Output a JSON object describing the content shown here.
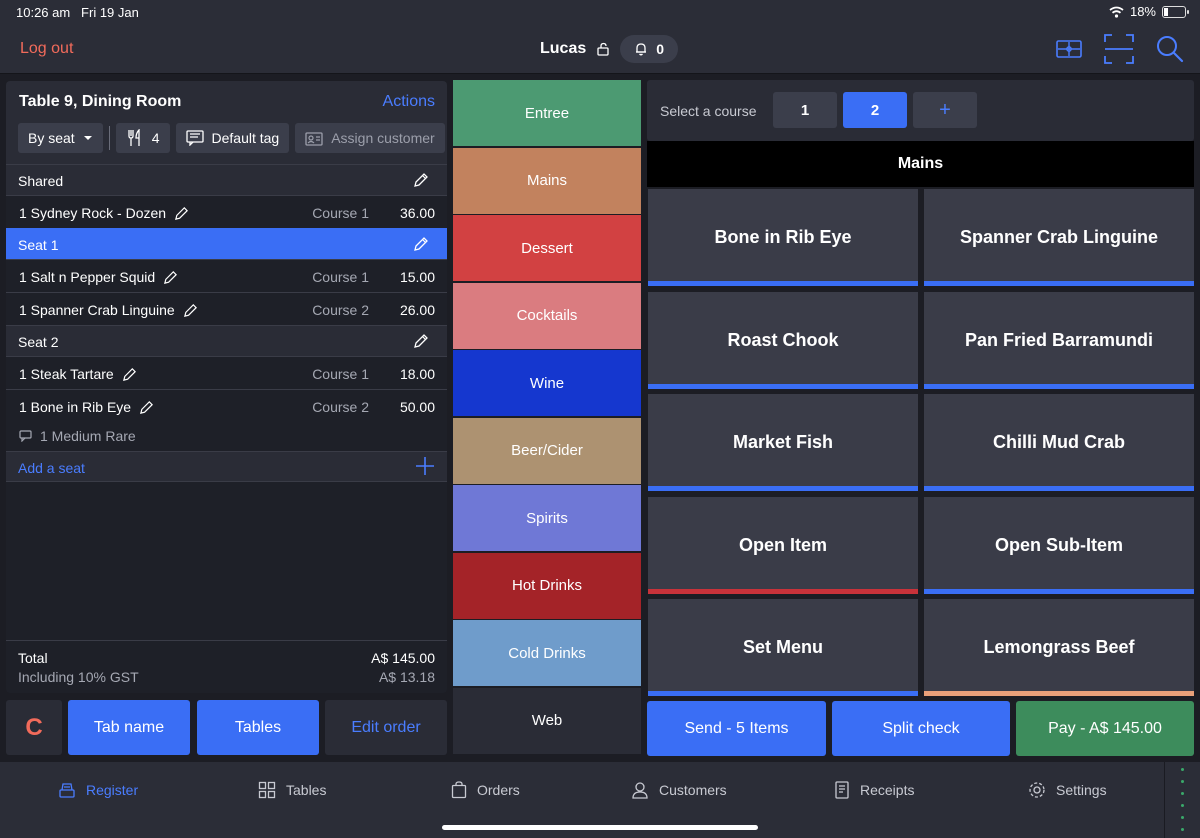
{
  "status": {
    "time": "10:26 am",
    "date": "Fri 19 Jan",
    "battery": "18%",
    "battery_level": 0.18
  },
  "top": {
    "logout": "Log out",
    "user": "Lucas",
    "notifications": "0"
  },
  "order": {
    "title": "Table 9, Dining Room",
    "actions": "Actions",
    "view": "By seat",
    "covers": "4",
    "tag": "Default tag",
    "assign": "Assign customer",
    "shared_label": "Shared",
    "shared_items": [
      {
        "name": "1  Sydney Rock - Dozen",
        "course": "Course 1",
        "price": "36.00"
      }
    ],
    "seat1_label": "Seat 1",
    "seat1_items": [
      {
        "name": "1  Salt n Pepper Squid",
        "course": "Course 1",
        "price": "15.00"
      },
      {
        "name": "1  Spanner Crab Linguine",
        "course": "Course 2",
        "price": "26.00"
      }
    ],
    "seat2_label": "Seat 2",
    "seat2_items": [
      {
        "name": "1  Steak Tartare",
        "course": "Course 1",
        "price": "18.00"
      },
      {
        "name": "1  Bone in Rib Eye",
        "course": "Course 2",
        "price": "50.00",
        "modifier": "1  Medium Rare"
      }
    ],
    "add_seat": "Add a seat",
    "total_label": "Total",
    "total_value": "A$ 145.00",
    "gst_label": "Including 10% GST",
    "gst_value": "A$ 13.18"
  },
  "left_buttons": {
    "clear": "C",
    "tab_name": "Tab name",
    "tables": "Tables",
    "edit_order": "Edit order"
  },
  "categories": [
    {
      "label": "Entree",
      "color": "#4c9a72"
    },
    {
      "label": "Mains",
      "color": "#c2825e"
    },
    {
      "label": "Dessert",
      "color": "#d24142"
    },
    {
      "label": "Cocktails",
      "color": "#da7c80"
    },
    {
      "label": "Wine",
      "color": "#1537cf"
    },
    {
      "label": "Beer/Cider",
      "color": "#ad9271"
    },
    {
      "label": "Spirits",
      "color": "#6f78d6"
    },
    {
      "label": "Hot Drinks",
      "color": "#a42328"
    },
    {
      "label": "Cold Drinks",
      "color": "#6f9ccb"
    },
    {
      "label": "Web",
      "color": "#2a2c36"
    }
  ],
  "course": {
    "label": "Select a course",
    "options": [
      "1",
      "2"
    ],
    "active": "2",
    "add": "+"
  },
  "section_title": "Mains",
  "products": [
    {
      "label": "Bone in Rib Eye",
      "bar": "#3a6ef5"
    },
    {
      "label": "Spanner Crab Linguine",
      "bar": "#3a6ef5"
    },
    {
      "label": "Roast Chook",
      "bar": "#3a6ef5"
    },
    {
      "label": "Pan Fried Barramundi",
      "bar": "#3a6ef5"
    },
    {
      "label": "Market Fish",
      "bar": "#3a6ef5"
    },
    {
      "label": "Chilli Mud Crab",
      "bar": "#3a6ef5"
    },
    {
      "label": "Open Item",
      "bar": "#c8323a"
    },
    {
      "label": "Open Sub-Item",
      "bar": "#3a6ef5"
    },
    {
      "label": "Set Menu",
      "bar": "#3a6ef5"
    },
    {
      "label": "Lemongrass Beef",
      "bar": "#e9a07a"
    }
  ],
  "actions": {
    "send": "Send - 5 Items",
    "split": "Split check",
    "pay": "Pay - A$ 145.00"
  },
  "nav": [
    {
      "label": "Register",
      "icon": "register-icon",
      "active": true
    },
    {
      "label": "Tables",
      "icon": "tables-icon",
      "active": false
    },
    {
      "label": "Orders",
      "icon": "orders-icon",
      "active": false
    },
    {
      "label": "Customers",
      "icon": "customers-icon",
      "active": false
    },
    {
      "label": "Receipts",
      "icon": "receipts-icon",
      "active": false
    },
    {
      "label": "Settings",
      "icon": "settings-icon",
      "active": false
    }
  ]
}
